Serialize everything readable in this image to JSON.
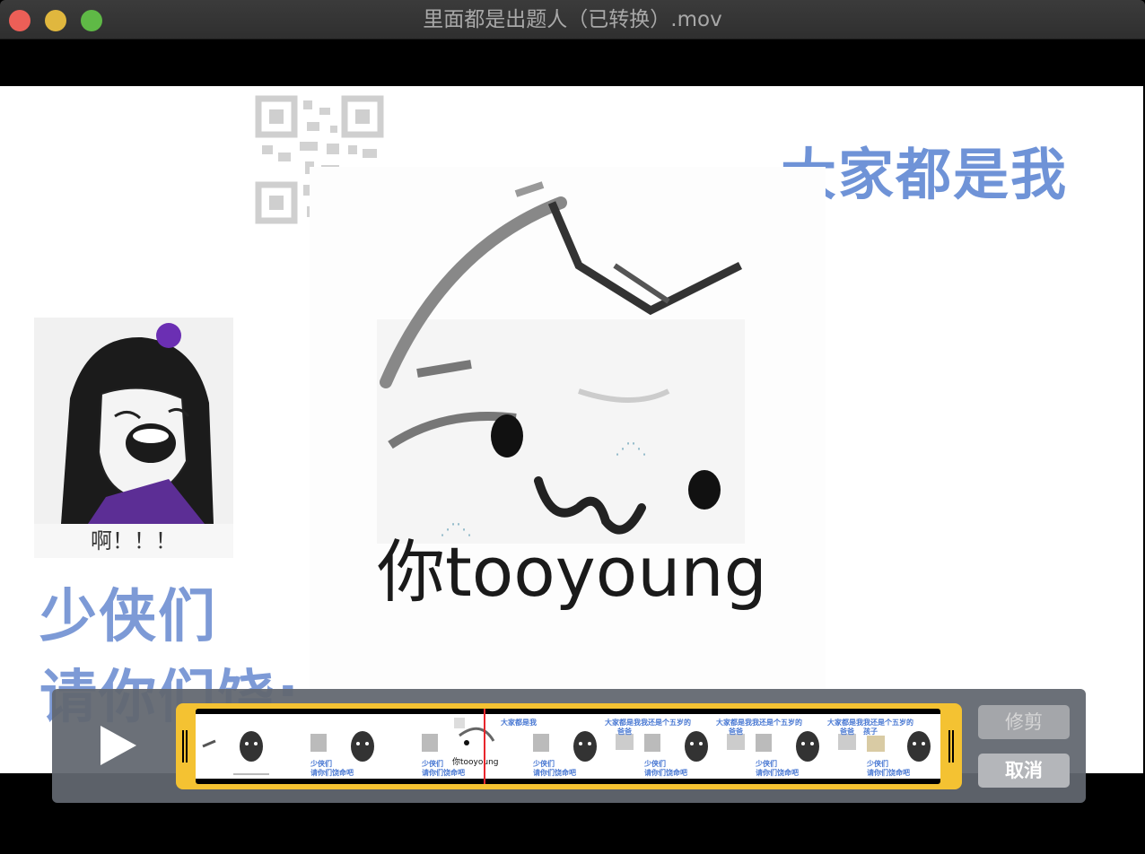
{
  "window": {
    "title": "里面都是出题人（已转换）.mov"
  },
  "video": {
    "headline_right": "大家都是我",
    "headline_left_line1": "少侠们",
    "headline_left_line2": "请你们饶:",
    "girl_caption": "啊！！！",
    "meme_caption": "你tooyoung"
  },
  "trim_bar": {
    "trim_label": "修剪",
    "cancel_label": "取消",
    "thumbnails": {
      "t1": "少侠们",
      "t1b": "请你们饶命吧",
      "t2": "少侠们",
      "t2b": "请你们饶命吧",
      "t3": "大家都是我",
      "t4": "少侠们",
      "t4b": "请你们饶命吧",
      "t5": "大家都是我",
      "t5b": "爸爸",
      "t6": "我还是个五岁的",
      "t7": "少侠们",
      "t7b": "请你们饶命吧",
      "t8": "大家都是我",
      "t8b": "爸爸",
      "t9": "我还是个五岁的",
      "t10": "少侠们",
      "t10b": "请你们饶命吧",
      "t11": "大家都是我",
      "t11b": "爸爸",
      "t12": "我还是个五岁的",
      "t12b": "孩子",
      "t13": "少侠们",
      "t13b": "请你们饶命吧",
      "t_meme": "你tooyoung"
    }
  },
  "colors": {
    "accent_blue": "#6f93d7",
    "trim_yellow": "#f4c232",
    "playhead_red": "#e8262c"
  }
}
